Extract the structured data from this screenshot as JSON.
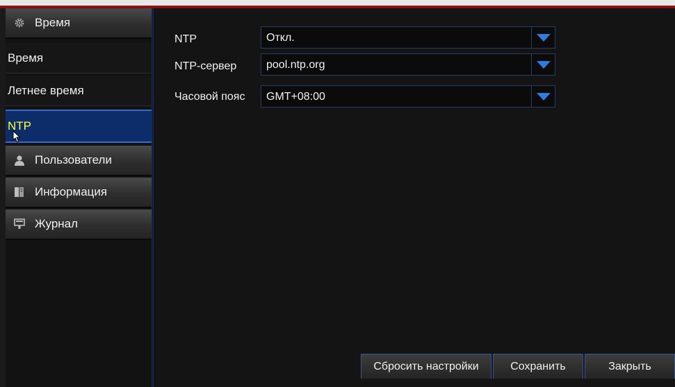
{
  "sidebar": {
    "items": [
      {
        "label": "Время",
        "kind": "category",
        "icon": "gear-icon"
      },
      {
        "label": "Время",
        "kind": "subitem"
      },
      {
        "label": "Летнее время",
        "kind": "subitem"
      },
      {
        "label": "NTP",
        "kind": "subitem",
        "active": true
      },
      {
        "label": "Пользователи",
        "kind": "category",
        "icon": "user-icon"
      },
      {
        "label": "Информация",
        "kind": "category",
        "icon": "info-book-icon"
      },
      {
        "label": "Журнал",
        "kind": "category",
        "icon": "log-icon"
      }
    ]
  },
  "form": {
    "ntp": {
      "label": "NTP",
      "value": "Откл."
    },
    "server": {
      "label": "NTP-сервер",
      "value": "pool.ntp.org"
    },
    "timezone": {
      "label": "Часовой пояс",
      "value": "GMT+08:00"
    }
  },
  "buttons": {
    "reset": "Сбросить настройки",
    "save": "Сохранить",
    "close": "Закрыть"
  },
  "colors": {
    "accent_blue": "#2f7be0",
    "active_item_bg": "#0c2d6a",
    "active_item_text": "#ffff33",
    "top_stripe": "#9a1a1a"
  }
}
